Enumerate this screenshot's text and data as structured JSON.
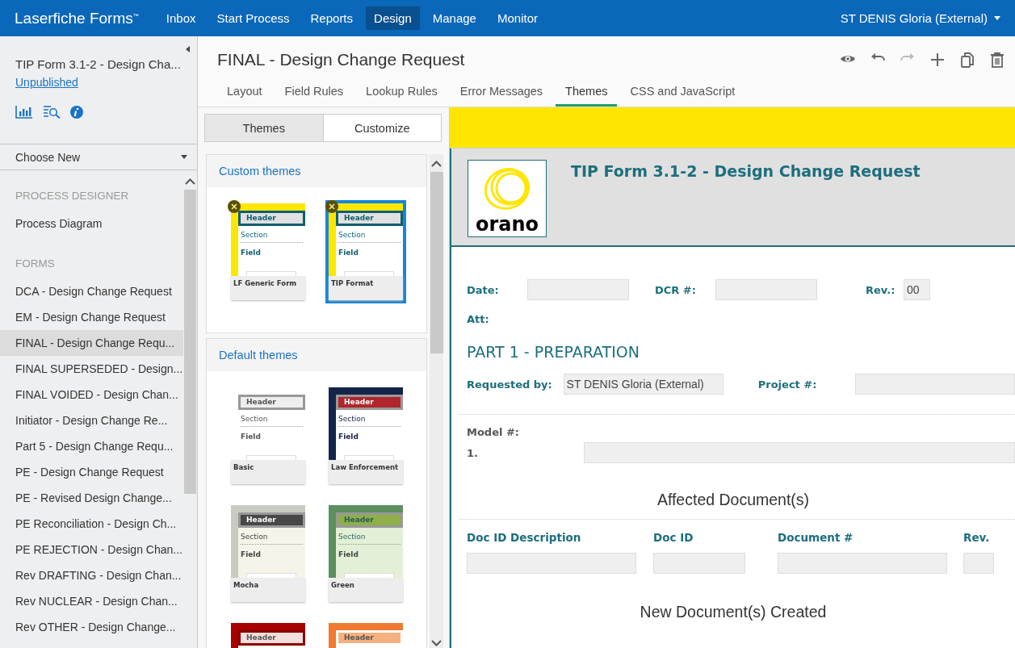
{
  "top_bar": {
    "app_name": "Laserfiche Forms",
    "trademark": "™",
    "nav": [
      {
        "label": "Inbox",
        "selected": false
      },
      {
        "label": "Start Process",
        "selected": false
      },
      {
        "label": "Reports",
        "selected": false
      },
      {
        "label": "Design",
        "selected": true
      },
      {
        "label": "Manage",
        "selected": false
      },
      {
        "label": "Monitor",
        "selected": false
      }
    ],
    "user": "ST DENIS Gloria (External)"
  },
  "sidebar": {
    "form_title": "TIP Form 3.1-2 - Design Cha...",
    "status": "Unpublished",
    "choose_new": "Choose New",
    "sections": [
      {
        "heading": "PROCESS DESIGNER",
        "items": [
          {
            "label": "Process Diagram",
            "selected": false
          }
        ]
      },
      {
        "heading": "FORMS",
        "items": [
          {
            "label": "DCA - Design Change Request",
            "selected": false
          },
          {
            "label": "EM - Design Change Request",
            "selected": false
          },
          {
            "label": "FINAL - Design Change Requ...",
            "selected": true
          },
          {
            "label": "FINAL SUPERSEDED - Design...",
            "selected": false
          },
          {
            "label": "FINAL VOIDED - Design Chan...",
            "selected": false
          },
          {
            "label": "Initiator - Design Change Re...",
            "selected": false
          },
          {
            "label": "Part 5 - Design Change Requ...",
            "selected": false
          },
          {
            "label": "PE - Design Change Request",
            "selected": false
          },
          {
            "label": "PE - Revised Design Change...",
            "selected": false
          },
          {
            "label": "PE Reconciliation - Design Ch...",
            "selected": false
          },
          {
            "label": "PE REJECTION - Design Chan...",
            "selected": false
          },
          {
            "label": "Rev DRAFTING - Design Chan...",
            "selected": false
          },
          {
            "label": "Rev NUCLEAR - Design Chan...",
            "selected": false
          },
          {
            "label": "Rev OTHER - Design Change...",
            "selected": false
          }
        ]
      }
    ]
  },
  "editor": {
    "title": "FINAL - Design Change Request",
    "toolbar": [
      {
        "kind": "preview",
        "disabled": false
      },
      {
        "kind": "undo",
        "disabled": false
      },
      {
        "kind": "redo",
        "disabled": true
      },
      {
        "kind": "add",
        "disabled": false
      },
      {
        "kind": "copy",
        "disabled": false
      },
      {
        "kind": "delete",
        "disabled": false
      }
    ],
    "tabs": [
      {
        "label": "Layout",
        "selected": false
      },
      {
        "label": "Field Rules",
        "selected": false
      },
      {
        "label": "Lookup Rules",
        "selected": false
      },
      {
        "label": "Error Messages",
        "selected": false
      },
      {
        "label": "Themes",
        "selected": true
      },
      {
        "label": "CSS and JavaScript",
        "selected": false
      }
    ]
  },
  "theme_panel": {
    "subtabs": [
      {
        "label": "Themes",
        "selected": true
      },
      {
        "label": "Customize",
        "selected": false
      }
    ],
    "groups": [
      {
        "title": "Custom themes",
        "themes": [
          {
            "kind": "lf-generic",
            "header": "Header",
            "section": "Section",
            "field": "Field",
            "name": "LF Generic Form",
            "removable": true,
            "selected": false
          },
          {
            "kind": "tip",
            "header": "Header",
            "section": "Section",
            "field": "Field",
            "name": "TIP Format",
            "removable": true,
            "selected": true
          }
        ]
      },
      {
        "title": "Default themes",
        "themes": [
          {
            "kind": "basic",
            "header": "Header",
            "section": "Section",
            "field": "Field",
            "name": "Basic",
            "removable": false,
            "selected": false
          },
          {
            "kind": "law",
            "header": "Header",
            "section": "Section",
            "field": "Field",
            "name": "Law Enforcement",
            "removable": false,
            "selected": false
          },
          {
            "kind": "mocha",
            "header": "Header",
            "section": "Section",
            "field": "Field",
            "name": "Mocha",
            "removable": false,
            "selected": false
          },
          {
            "kind": "green",
            "header": "Header",
            "section": "Section",
            "field": "Field",
            "name": "Green",
            "removable": false,
            "selected": false
          },
          {
            "kind": "red",
            "header": "Header",
            "removable": false,
            "selected": false
          },
          {
            "kind": "orange",
            "header": "Header",
            "removable": false,
            "selected": false
          }
        ]
      }
    ]
  },
  "form": {
    "title": "TIP Form 3.1-2 - Design Change Request",
    "logo_text": "orano",
    "row_1": [
      {
        "label": "Date:"
      },
      {
        "label": "DCR #:"
      },
      {
        "label": "Rev.:",
        "value": "00"
      }
    ],
    "attachment_label": "Att:",
    "part_heading": "PART 1 - PREPARATION",
    "row_2": [
      {
        "label": "Requested by:",
        "value": "ST DENIS Gloria (External)"
      },
      {
        "label": "Project #:"
      }
    ],
    "model_label": "Model #:",
    "model_items": [
      {
        "number": "1."
      }
    ],
    "affected_heading": "Affected Document(s)",
    "affected_columns": [
      "Doc ID Description",
      "Doc ID",
      "Document #",
      "Rev."
    ],
    "new_heading": "New Document(s) Created"
  }
}
